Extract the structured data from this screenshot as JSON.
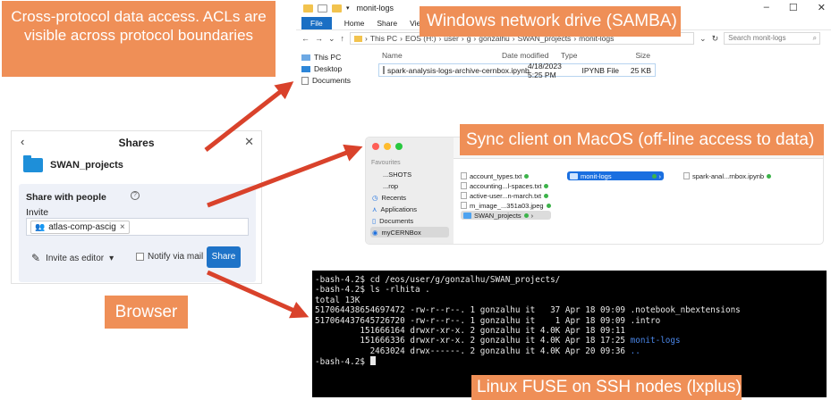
{
  "callout": "Cross-protocol data access. ACLs are visible across protocol boundaries",
  "labels": {
    "samba": "Windows network drive (SAMBA)",
    "sync": "Sync client on MacOS (off-line access to data)",
    "browser": "Browser",
    "fuse": "Linux FUSE on SSH nodes (lxplus)"
  },
  "explorer": {
    "title": "monit-logs",
    "ribbon": [
      "File",
      "Home",
      "Share",
      "View"
    ],
    "path": [
      "This PC",
      "EOS (H:)",
      "user",
      "g",
      "gonzalhu",
      "SWAN_projects",
      "monit-logs"
    ],
    "search_placeholder": "Search monit-logs",
    "nav": [
      "This PC",
      "Desktop",
      "Documents"
    ],
    "columns": [
      "Name",
      "Date modified",
      "Type",
      "Size"
    ],
    "file": {
      "name": "spark-analysis-logs-archive-cernbox.ipynb",
      "date": "4/18/2023 5:25 PM",
      "type": "IPYNB File",
      "size": "25 KB"
    }
  },
  "shares": {
    "title": "Shares",
    "folder": "SWAN_projects",
    "share_with": "Share with people",
    "invite_label": "Invite",
    "chip": "atlas-comp-ascig",
    "permission": "Invite as editor",
    "notify": "Notify via mail",
    "share_button": "Share"
  },
  "finder": {
    "favourites": "Favourites",
    "sidebar": [
      "...SHOTS",
      "...rop",
      "Recents",
      "Applications",
      "Documents",
      "myCERNBox"
    ],
    "col1": [
      "account_types.txt",
      "accounting...l-spaces.txt",
      "active-user...n-march.txt",
      "m_image_...351a03.jpeg",
      "SWAN_projects"
    ],
    "col2": [
      "monit-logs"
    ],
    "col3": [
      "spark-anal...rnbox.ipynb"
    ]
  },
  "terminal": {
    "lines": [
      "-bash-4.2$ cd /eos/user/g/gonzalhu/SWAN_projects/",
      "-bash-4.2$ ls -rlhita .",
      "total 13K",
      "517064438654697472 -rw-r--r--. 1 gonzalhu it   37 Apr 18 09:09 .notebook_nbextensions",
      "517064437645726720 -rw-r--r--. 1 gonzalhu it    1 Apr 18 09:09 .intro",
      "         151666164 drwxr-xr-x. 2 gonzalhu it 4.0K Apr 18 09:11 ",
      "         151666336 drwxr-xr-x. 2 gonzalhu it 4.0K Apr 18 17:25 ",
      "           2463024 drwx------. 2 gonzalhu it 4.0K Apr 20 09:36 ",
      "-bash-4.2$ "
    ],
    "highlights": [
      "monit-logs",
      ".."
    ]
  },
  "colors": {
    "accent": "#ef8f57",
    "arrow": "#d9422b",
    "windows_blue": "#1a6fc4",
    "terminal_bg": "#000000"
  }
}
